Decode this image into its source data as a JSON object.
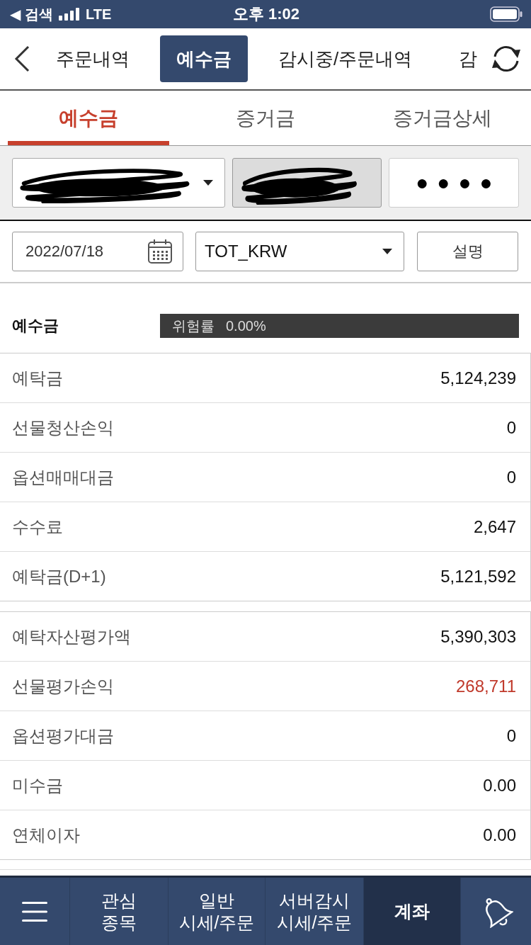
{
  "status_bar": {
    "back_label": "◀ 검색",
    "network": "LTE",
    "time": "오후 1:02"
  },
  "top_nav": {
    "tabs": [
      {
        "label": "주문내역",
        "selected": false
      },
      {
        "label": "예수금",
        "selected": true
      },
      {
        "label": "감시중/주문내역",
        "selected": false
      },
      {
        "label": "감",
        "selected": false
      }
    ]
  },
  "sub_tabs": [
    {
      "label": "예수금",
      "selected": true
    },
    {
      "label": "증거금",
      "selected": false
    },
    {
      "label": "증거금상세",
      "selected": false
    }
  ],
  "account_bar": {
    "account": {
      "redacted": true
    },
    "name": {
      "redacted": true,
      "disabled": true
    },
    "password": {
      "value": "●●●●"
    }
  },
  "filters": {
    "date": "2022/07/18",
    "currency": "TOT_KRW",
    "help_button": "설명"
  },
  "summary": {
    "title": "예수금",
    "risk_label": "위험률",
    "risk_value": "0.00%"
  },
  "tables": [
    {
      "rows": [
        {
          "label": "예탁금",
          "value": "5,124,239",
          "color": "#111111"
        },
        {
          "label": "선물청산손익",
          "value": "0",
          "color": "#111111"
        },
        {
          "label": "옵션매매대금",
          "value": "0",
          "color": "#111111"
        },
        {
          "label": "수수료",
          "value": "2,647",
          "color": "#111111"
        },
        {
          "label": "예탁금(D+1)",
          "value": "5,121,592",
          "color": "#111111"
        }
      ]
    },
    {
      "rows": [
        {
          "label": "예탁자산평가액",
          "value": "5,390,303",
          "color": "#111111"
        },
        {
          "label": "선물평가손익",
          "value": "268,711",
          "color": "#c0392b"
        },
        {
          "label": "옵션평가대금",
          "value": "0",
          "color": "#111111"
        },
        {
          "label": "미수금",
          "value": "0.00",
          "color": "#111111"
        },
        {
          "label": "연체이자",
          "value": "0.00",
          "color": "#111111"
        }
      ]
    }
  ],
  "bottom_nav": {
    "tabs": [
      {
        "label": "관심\n종목",
        "selected": false
      },
      {
        "label": "일반\n시세/주문",
        "selected": false
      },
      {
        "label": "서버감시\n시세/주문",
        "selected": false
      },
      {
        "label": "계좌",
        "selected": true
      }
    ]
  }
}
